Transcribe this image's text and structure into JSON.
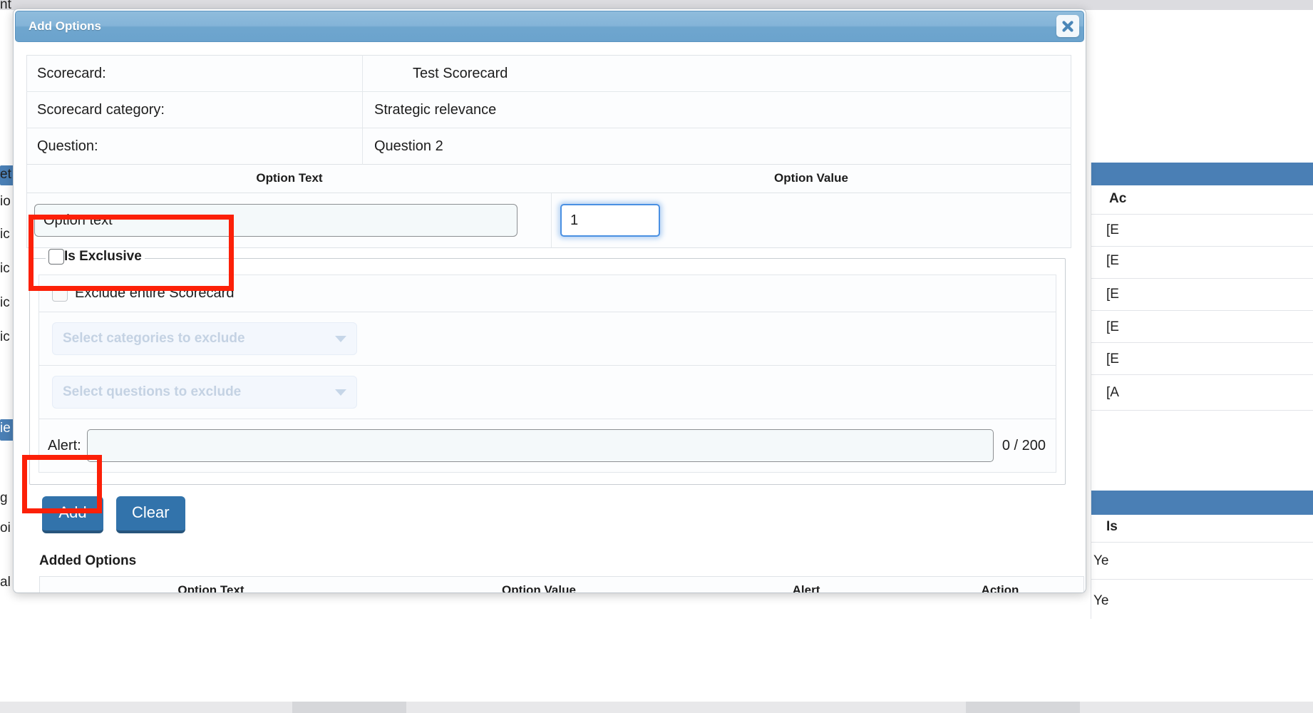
{
  "modal": {
    "title": "Add Options",
    "close_icon": "close-x-icon",
    "info_rows": [
      {
        "label": "Scorecard:",
        "value": "Test Scorecard"
      },
      {
        "label": "Scorecard category:",
        "value": "Strategic relevance"
      },
      {
        "label": "Question:",
        "value": "Question 2"
      }
    ],
    "option_headers": {
      "text": "Option Text",
      "value": "Option Value"
    },
    "option_inputs": {
      "text_value": "Option text",
      "text_placeholder": "Option text",
      "number_value": "1",
      "number_placeholder": "1"
    },
    "exclusive": {
      "legend": "Is Exclusive",
      "legend_checkbox_checked": false,
      "exclude_scorecard_label": "Exclude entire Scorecard",
      "exclude_scorecard_checked": false,
      "select_categories_placeholder": "Select categories to exclude",
      "select_questions_placeholder": "Select questions to exclude",
      "caret_icon": "chevron-down-icon",
      "alert_label": "Alert:",
      "alert_value": "",
      "alert_counter": "0 / 200"
    },
    "buttons": {
      "add": "Add",
      "clear": "Clear"
    },
    "added_options": {
      "title": "Added Options",
      "columns": [
        "Option Text",
        "Option Value",
        "Alert",
        "Action"
      ],
      "rows": []
    }
  },
  "background": {
    "left_fragments": [
      "nt",
      "et",
      "io",
      "ic",
      "ic",
      "ic",
      "ic",
      "ie",
      "g",
      "oi",
      "al"
    ],
    "right_header": "Ac",
    "right_rows": [
      "[E",
      "[E",
      "[E",
      "[E",
      "[E",
      "[A"
    ],
    "right_is_label": "Is",
    "right_yes_rows": [
      "Ye",
      "Ye"
    ]
  },
  "colors": {
    "accent_blue": "#3273ab",
    "header_blue": "#7fb0d6",
    "annotation_red": "#fc2008",
    "focus_blue": "#4a90e2",
    "placeholder_blue": "#c4d2e3"
  }
}
